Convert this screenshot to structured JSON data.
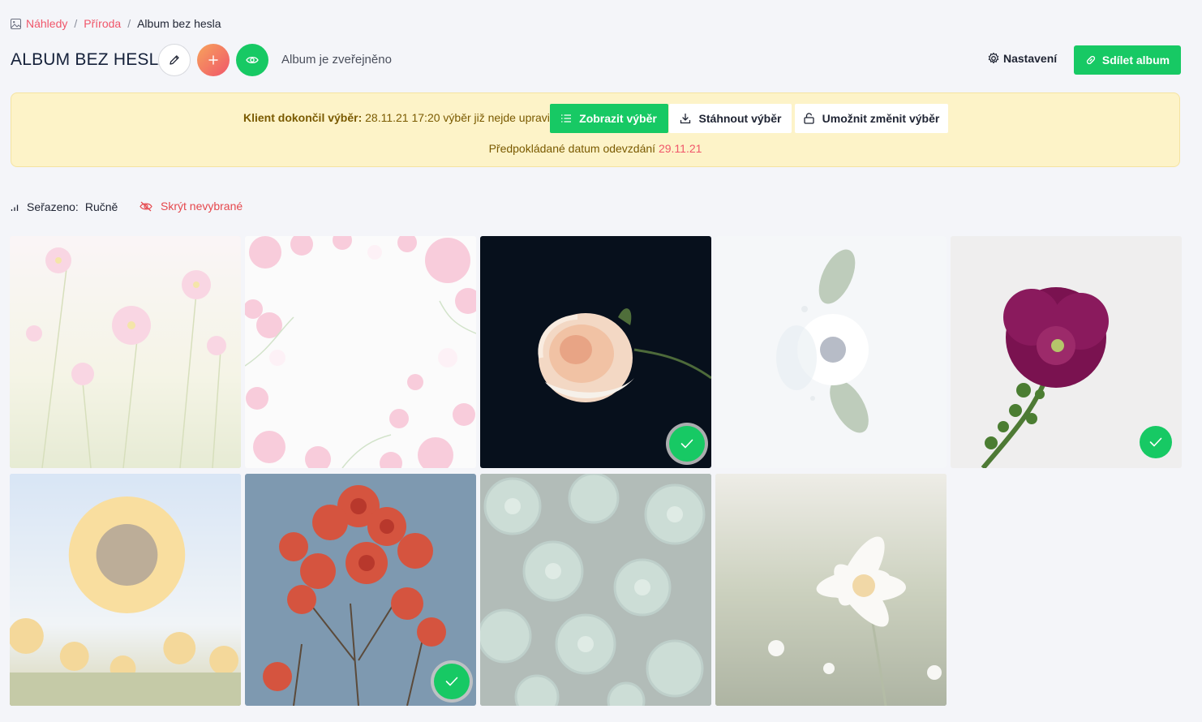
{
  "breadcrumb": {
    "items": [
      "Náhledy",
      "Příroda"
    ],
    "separator": "/",
    "current": "Album bez hesla"
  },
  "header": {
    "title": "ALBUM BEZ HESLA",
    "status": "Album je zveřejněno",
    "settings_label": "Nastavení",
    "share_label": "Sdílet album"
  },
  "banner": {
    "client_label": "Klient dokončil výběr:",
    "client_text": "28.11.21 17:20 výběr již nejde upravit.",
    "show_label": "Zobrazit výběr",
    "download_label": "Stáhnout výběr",
    "allow_label": "Umožnit změnit výběr",
    "deadline_label": "Předpokládané datum odevzdání",
    "deadline_date": "29.11.21"
  },
  "toolbar": {
    "sort_label": "Seřazeno:",
    "sort_value": "Ručně",
    "hide_label": "Skrýt nevybrané"
  },
  "photos": [
    {
      "subject": "pink cosmos flowers",
      "selected": false
    },
    {
      "subject": "pink flower frame",
      "selected": false
    },
    {
      "subject": "peach rose on dark",
      "selected": true
    },
    {
      "subject": "white anemone",
      "selected": false
    },
    {
      "subject": "purple hollyhock",
      "selected": true
    },
    {
      "subject": "sunflower field",
      "selected": false
    },
    {
      "subject": "red roses",
      "selected": true
    },
    {
      "subject": "succulents",
      "selected": false
    },
    {
      "subject": "daisy in meadow",
      "selected": false
    }
  ],
  "colors": {
    "accent": "#17c964",
    "link": "#f0566a",
    "banner_bg": "#fdf3c8",
    "danger": "#e5484d"
  }
}
